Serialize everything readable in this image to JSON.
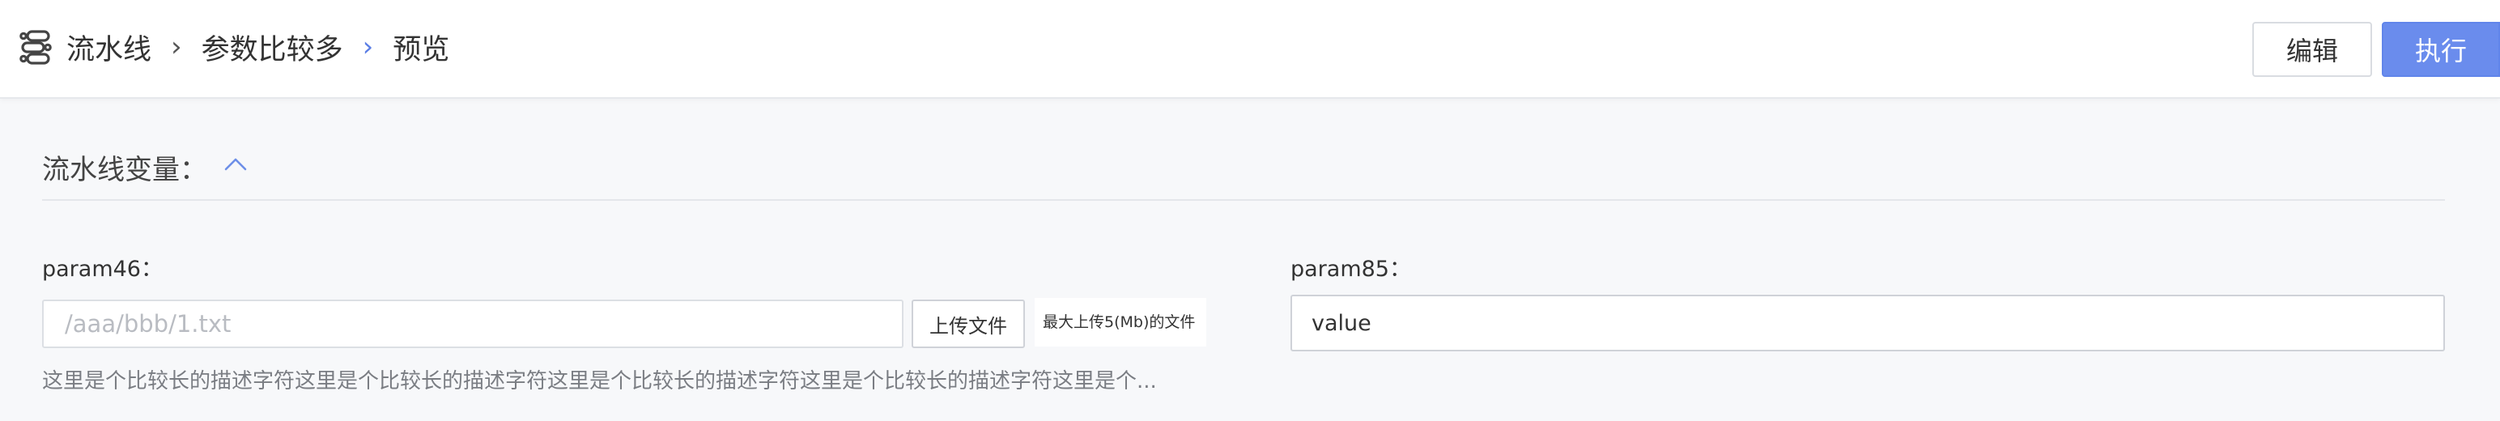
{
  "header": {
    "breadcrumb": {
      "root": "流水线",
      "middle": "参数比较多",
      "current": "预览"
    },
    "edit_label": "编辑",
    "run_label": "执行"
  },
  "section": {
    "title": "流水线变量："
  },
  "params": [
    {
      "label": "param46：",
      "placeholder": "/aaa/bbb/1.txt",
      "upload_label": "上传文件",
      "upload_hint": "最大上传5(Mb)的文件",
      "description": "这里是个比较长的描述字符这里是个比较长的描述字符这里是个比较长的描述字符这里是个比较长的描述字符这里是个..."
    },
    {
      "label": "param85：",
      "value": "value"
    }
  ],
  "colors": {
    "primary": "#6a8ced",
    "breadcrumb_active_separator": "#5b7ee5"
  }
}
